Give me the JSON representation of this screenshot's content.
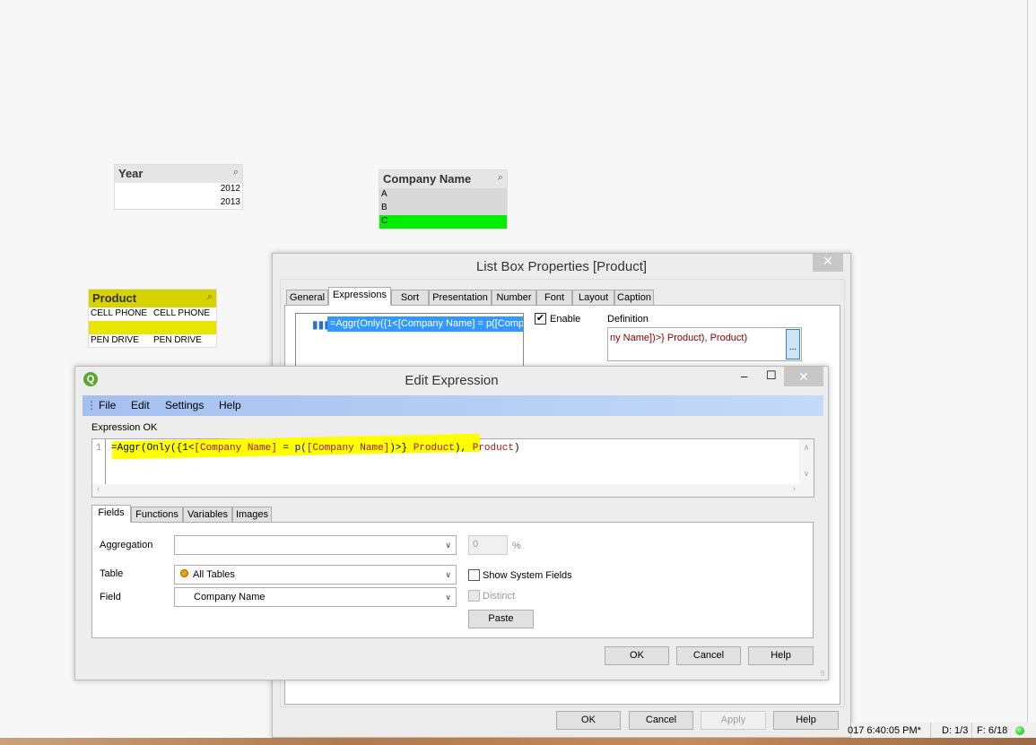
{
  "listboxes": {
    "year": {
      "title": "Year",
      "values": [
        "2012",
        "2013"
      ]
    },
    "company": {
      "title": "Company Name",
      "values": [
        "A",
        "B",
        "C"
      ],
      "selected": "C",
      "selected_color": "#00ee00"
    },
    "product": {
      "title": "Product",
      "rows": [
        [
          "CELL PHONE",
          "CELL PHONE"
        ],
        [
          "",
          ""
        ],
        [
          "PEN DRIVE",
          "PEN DRIVE"
        ]
      ]
    }
  },
  "props_dialog": {
    "title": "List Box Properties [Product]",
    "close": "✕",
    "tabs": [
      "General",
      "Expressions",
      "Sort",
      "Presentation",
      "Number",
      "Font",
      "Layout",
      "Caption"
    ],
    "active_tab": "Expressions",
    "expression_item": "=Aggr(Only({1<[Company Name] = p([Compa",
    "enable_label": "Enable",
    "enable_checked": true,
    "definition_label": "Definition",
    "definition_value": "ny Name])>} Product), Product)",
    "ellipsis": "...",
    "buttons": {
      "ok": "OK",
      "cancel": "Cancel",
      "apply": "Apply",
      "help": "Help"
    }
  },
  "edit_dialog": {
    "title": "Edit Expression",
    "icon_letter": "Q",
    "minimize": "‒",
    "maximize": "☐",
    "close": "✕",
    "menu": [
      "File",
      "Edit",
      "Settings",
      "Help"
    ],
    "status": "Expression OK",
    "line_number": "1",
    "expression": {
      "p1": "=Aggr(Only({1<",
      "p2": "[Company Name]",
      "p3": " = ",
      "p4": "p(",
      "p5": "[Company Name]",
      "p6": ")>} ",
      "p7": "Product",
      "p8": "), ",
      "p9": "Product",
      "p10": ")"
    },
    "tabs": [
      "Fields",
      "Functions",
      "Variables",
      "Images"
    ],
    "active_tab": "Fields",
    "aggregation_label": "Aggregation",
    "aggregation_value": "",
    "percent_value": "0",
    "percent_sign": "%",
    "table_label": "Table",
    "table_value": "All Tables",
    "field_label": "Field",
    "field_value": "Company Name",
    "show_system_fields": "Show System Fields",
    "distinct": "Distinct",
    "paste": "Paste",
    "buttons": {
      "ok": "OK",
      "cancel": "Cancel",
      "help": "Help"
    }
  },
  "statusbar": {
    "timestamp": "017 6:40:05 PM*",
    "d": "D: 1/3",
    "f": "F: 6/18"
  },
  "colors": {
    "highlight": "#ffff00",
    "selection_blue": "#3399ff",
    "menu_bar": "#a9c4f0"
  }
}
